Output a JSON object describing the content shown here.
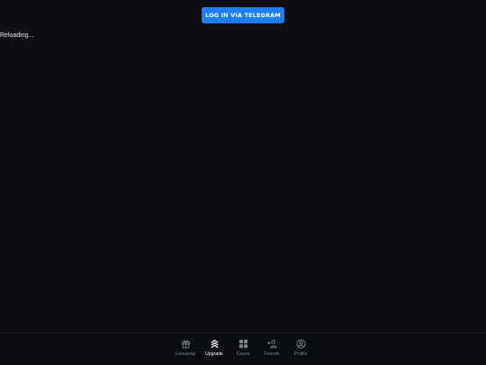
{
  "header": {
    "login_label": "LOG IN VIA TELEGRAM"
  },
  "main": {
    "status": "Reloading..."
  },
  "bottom_nav": {
    "active": "Upgrade",
    "items": [
      {
        "label": "Giveaway",
        "icon": "gift-icon"
      },
      {
        "label": "Upgrade",
        "icon": "upgrade-chevrons-icon"
      },
      {
        "label": "Cases",
        "icon": "cases-grid-icon"
      },
      {
        "label": "Friends",
        "icon": "add-friend-icon"
      },
      {
        "label": "Profile",
        "icon": "profile-icon"
      }
    ]
  },
  "colors": {
    "background": "#0d0f13",
    "accent": "#1e7ef5",
    "nav_inactive": "#7c828b",
    "nav_active": "#ffffff"
  }
}
